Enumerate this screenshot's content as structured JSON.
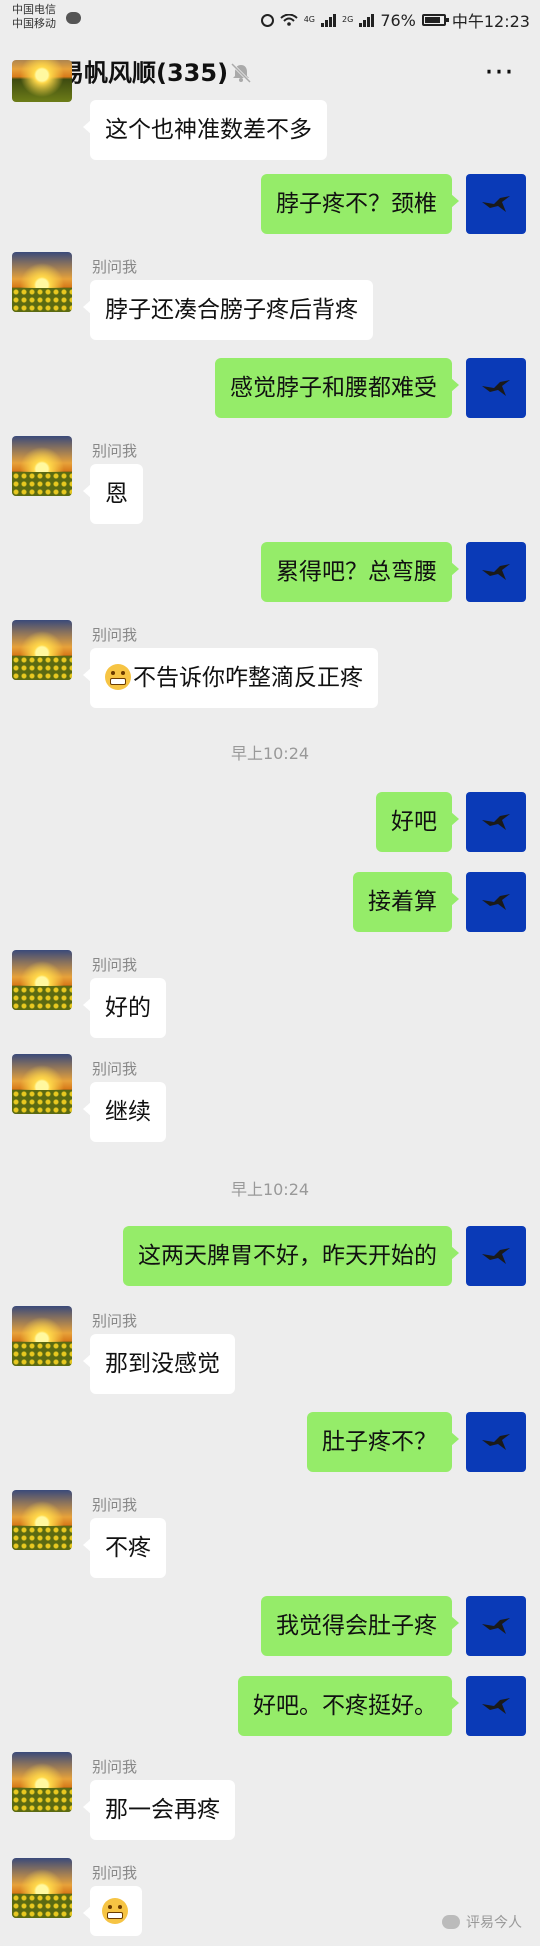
{
  "status_bar": {
    "carrier1": "中国电信",
    "carrier2": "中国移动",
    "net_top": "4G",
    "net_bottom": "2G",
    "battery": "76%",
    "time": "中午12:23"
  },
  "header": {
    "title": "易帆风顺(335)",
    "back_icon": "chevron-left-icon",
    "mute_icon": "bell-muted-icon",
    "more_icon": "more-icon"
  },
  "messages": [
    {
      "side": "left",
      "text": "这个也神准数差不多"
    },
    {
      "side": "right",
      "text": "脖子疼不？颈椎"
    },
    {
      "side": "left",
      "sender": "别问我",
      "text": "脖子还凑合膀子疼后背疼"
    },
    {
      "side": "right",
      "text": "感觉脖子和腰都难受"
    },
    {
      "side": "left",
      "sender": "别问我",
      "text": "恩"
    },
    {
      "side": "right",
      "text": "累得吧？总弯腰"
    },
    {
      "side": "left",
      "sender": "别问我",
      "text": "不告诉你咋整滴反正疼"
    },
    {
      "timestamp": "早上10:24"
    },
    {
      "side": "right",
      "text": "好吧"
    },
    {
      "side": "right",
      "text": "接着算"
    },
    {
      "side": "left",
      "sender": "别问我",
      "text": "好的"
    },
    {
      "side": "left",
      "sender": "别问我",
      "text": "继续"
    },
    {
      "timestamp": "早上10:24"
    },
    {
      "side": "right",
      "text": "这两天脾胃不好，昨天开始的"
    },
    {
      "side": "left",
      "sender": "别问我",
      "text": "那到没感觉"
    },
    {
      "side": "right",
      "text": "肚子疼不？"
    },
    {
      "side": "left",
      "sender": "别问我",
      "text": "不疼"
    },
    {
      "side": "right",
      "text": "我觉得会肚子疼"
    },
    {
      "side": "right",
      "text": "好吧。不疼挺好。"
    },
    {
      "side": "left",
      "sender": "别问我",
      "text": "那一会再疼"
    },
    {
      "side": "left",
      "sender": "别问我",
      "text": ""
    }
  ],
  "watermark": "评易今人",
  "colors": {
    "background": "#ededed",
    "bubble_out": "#95ec69",
    "bubble_in": "#ffffff",
    "avatar_blue": "#0a3ab7"
  }
}
